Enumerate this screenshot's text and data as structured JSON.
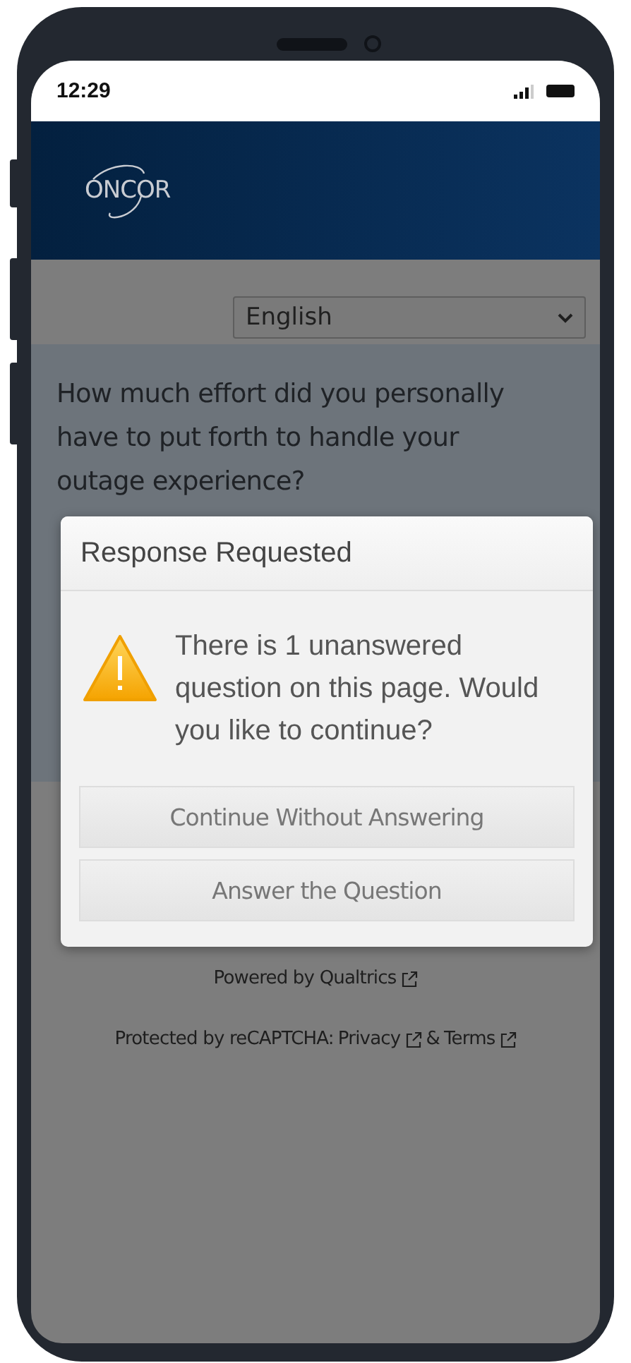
{
  "status_bar": {
    "time": "12:29"
  },
  "header": {
    "logo": "ONCOR"
  },
  "language_select": {
    "value": "English"
  },
  "question": {
    "text": "How much effort did you personally have to put forth to handle your outage experience?"
  },
  "dialog": {
    "title": "Response Requested",
    "message": "There is 1 unanswered question on this page. Would you like to continue?",
    "buttons": [
      "Continue Without Answering",
      "Answer the Question"
    ]
  },
  "footer": {
    "powered_by": "Powered by Qualtrics",
    "protected_by": "Protected by reCAPTCHA:",
    "privacy": "Privacy",
    "and": "&",
    "terms": "Terms"
  }
}
